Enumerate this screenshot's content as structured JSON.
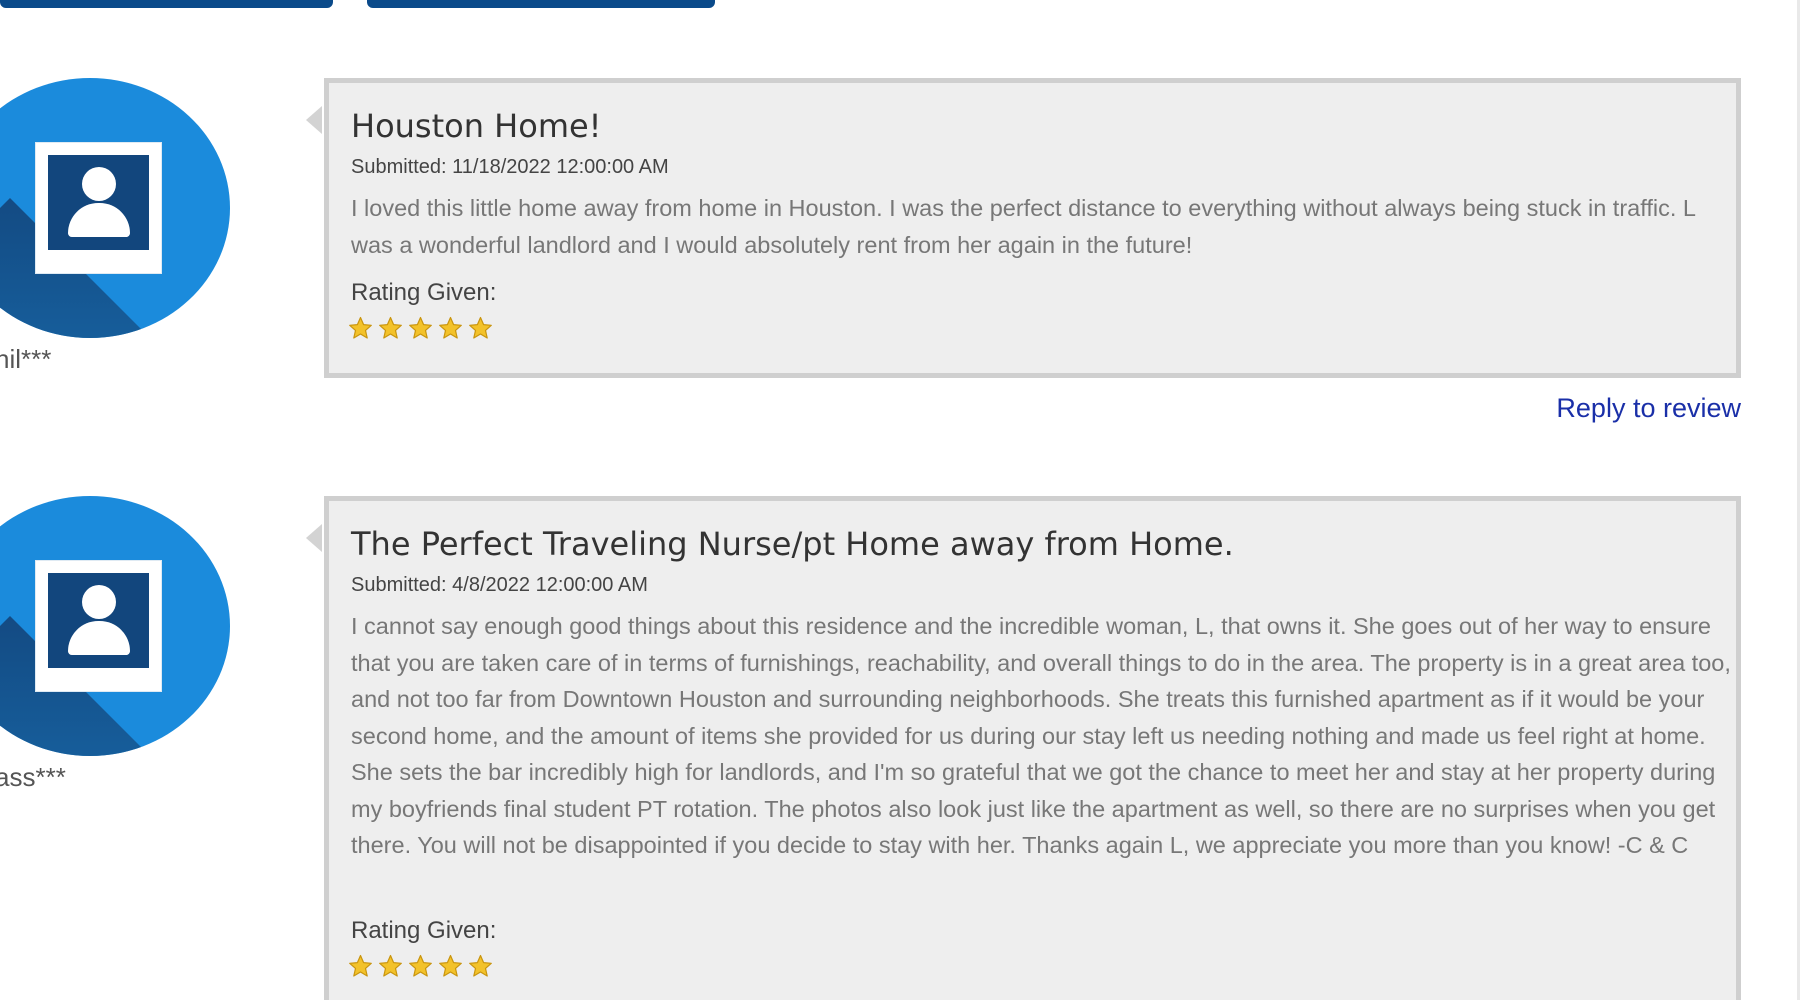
{
  "reviews": [
    {
      "username": "hil***",
      "title": "Houston Home!",
      "submitted": "Submitted: 11/18/2022 12:00:00 AM",
      "body": "I loved this little home away from home in Houston. I was the perfect distance to everything without always being stuck in traffic. L was a wonderful landlord and I would absolutely rent from her again in the future!",
      "rating_label": "Rating Given:",
      "rating": 5,
      "reply_label": "Reply to review"
    },
    {
      "username": "ass***",
      "title": "The Perfect Traveling Nurse/pt Home away from Home.",
      "submitted": "Submitted: 4/8/2022 12:00:00 AM",
      "body": "I cannot say enough good things about this residence and the incredible woman, L, that owns it. She goes out of her way to ensure that you are taken care of in terms of furnishings, reachability, and overall things to do in the area. The property is in a great area too, and not too far from Downtown Houston and surrounding neighborhoods. She treats this furnished apartment as if it would be your second home, and the amount of items she provided for us during our stay left us needing nothing and made us feel right at home. She sets the bar incredibly high for landlords, and I'm so grateful that we got the chance to meet her and stay at her property during my boyfriends final student PT rotation. The photos also look just like the apartment as well, so there are no surprises when you get there. You will not be disappointed if you decide to stay with her. Thanks again L, we appreciate you more than you know! -C & C",
      "rating_label": "Rating Given:",
      "rating": 5
    }
  ],
  "colors": {
    "avatar_blue": "#1b8bdc",
    "avatar_dark": "#12467d",
    "card_bg": "#eeeeee",
    "card_border": "#cfcfcf",
    "link": "#1a2fa8",
    "star": "#f3c22a",
    "top_tab": "#0a4a8a"
  },
  "icons": {
    "avatar": "user-avatar-icon",
    "star": "star-icon"
  }
}
